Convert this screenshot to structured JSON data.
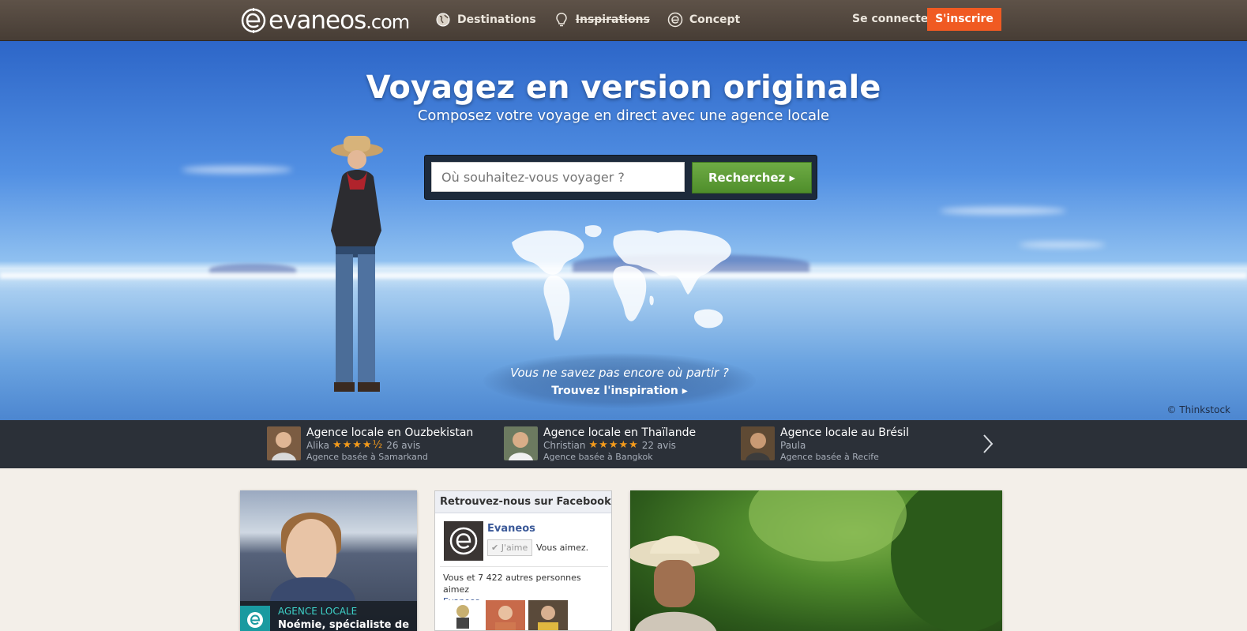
{
  "brand": {
    "name": "evaneos",
    "tld": ".com"
  },
  "nav": {
    "items": [
      {
        "label": "Destinations",
        "icon": "globe-icon"
      },
      {
        "label": "Inspirations",
        "icon": "lightbulb-icon"
      },
      {
        "label": "Concept",
        "icon": "evaneos-e-icon"
      }
    ],
    "login_label": "Se connecter",
    "signup_label": "S'inscrire"
  },
  "hero": {
    "title": "Voyagez en version originale",
    "subtitle": "Composez votre voyage en direct avec une agence locale",
    "search": {
      "placeholder": "Où souhaitez-vous voyager ?",
      "button_label": "Recherchez ▸"
    },
    "inspiration": {
      "question": "Vous ne savez pas encore où partir ?",
      "link_label": "Trouvez l'inspiration ▸"
    },
    "credit": "© Thinkstock"
  },
  "agencies": [
    {
      "title": "Agence locale en Ouzbekistan",
      "agent": "Alika",
      "stars": "★★★★½",
      "reviews": "26 avis",
      "based": "Agence basée à Samarkand"
    },
    {
      "title": "Agence locale en Thaïlande",
      "agent": "Christian",
      "stars": "★★★★★",
      "reviews": "22 avis",
      "based": "Agence basée à Bangkok"
    },
    {
      "title": "Agence locale au Brésil",
      "agent": "Paula",
      "stars": "",
      "reviews": "",
      "based": "Agence basée à Recife"
    }
  ],
  "cards": {
    "agent_tag": "AGENCE LOCALE",
    "agent_name": "Noémie, spécialiste de"
  },
  "facebook": {
    "header": "Retrouvez-nous sur Facebook",
    "page_name": "Evaneos",
    "like_label": "✔ J'aime",
    "you_like": "Vous aimez.",
    "count_text": "Vous et 7 422 autres personnes aimez",
    "count_link": "Evaneos."
  },
  "colors": {
    "topbar": "#4f443b",
    "signup": "#f05a22",
    "search_button": "#5f9e37",
    "strip": "#2b3038",
    "stars": "#f39a1b"
  }
}
